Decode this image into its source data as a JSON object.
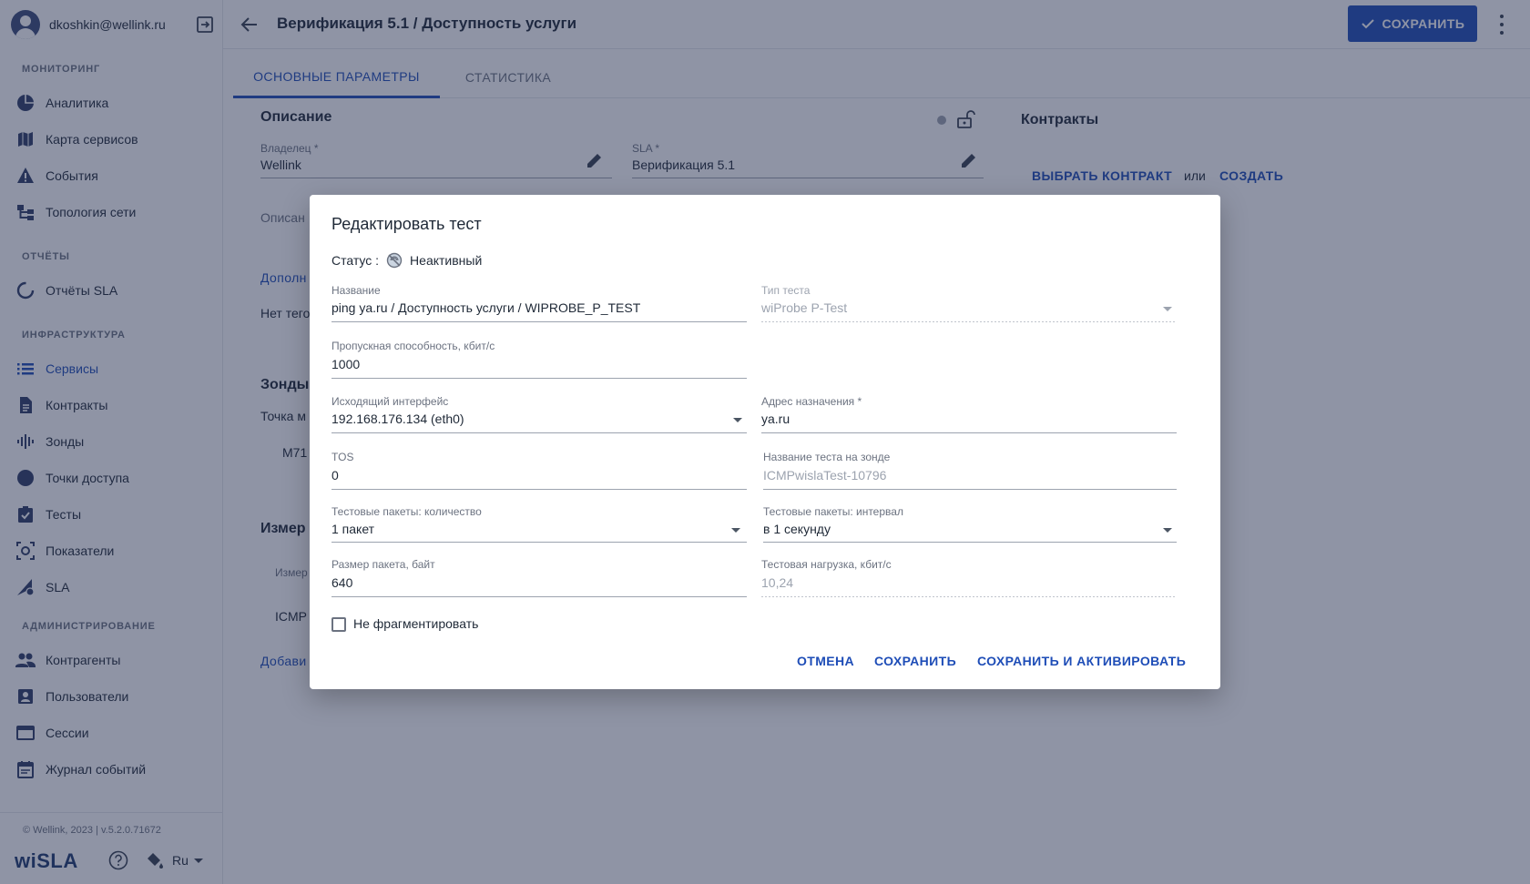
{
  "user": {
    "email": "dkoshkin@wellink.ru"
  },
  "sidebar": {
    "sections": [
      {
        "title": "МОНИТОРИНГ",
        "items": [
          {
            "label": "Аналитика",
            "icon": "pie-chart-icon"
          },
          {
            "label": "Карта сервисов",
            "icon": "map-icon"
          },
          {
            "label": "События",
            "icon": "warning-icon"
          },
          {
            "label": "Топология сети",
            "icon": "topology-icon"
          }
        ]
      },
      {
        "title": "ОТЧЁТЫ",
        "items": [
          {
            "label": "Отчёты SLA",
            "icon": "report-icon"
          }
        ]
      },
      {
        "title": "ИНФРАСТРУКТУРА",
        "items": [
          {
            "label": "Сервисы",
            "icon": "list-icon",
            "active": true
          },
          {
            "label": "Контракты",
            "icon": "document-icon"
          },
          {
            "label": "Зонды",
            "icon": "probe-icon"
          },
          {
            "label": "Точки доступа",
            "icon": "circle-icon"
          },
          {
            "label": "Тесты",
            "icon": "check-box-icon"
          },
          {
            "label": "Показатели",
            "icon": "metrics-icon"
          },
          {
            "label": "SLA",
            "icon": "sla-icon"
          }
        ]
      },
      {
        "title": "АДМИНИСТРИРОВАНИЕ",
        "items": [
          {
            "label": "Контрагенты",
            "icon": "people-icon"
          },
          {
            "label": "Пользователи",
            "icon": "user-card-icon"
          },
          {
            "label": "Сессии",
            "icon": "window-icon"
          },
          {
            "label": "Журнал событий",
            "icon": "calendar-icon"
          }
        ]
      }
    ],
    "footer": {
      "copyright": "© Wellink, 2023 | v.5.2.0.71672",
      "logo": "wiSLA",
      "language": "Ru"
    }
  },
  "header": {
    "title": "Верификация 5.1 / Доступность услуги",
    "save_label": "СОХРАНИТЬ"
  },
  "tabs": [
    {
      "label": "ОСНОВНЫЕ ПАРАМЕТРЫ",
      "active": true
    },
    {
      "label": "СТАТИСТИКА",
      "active": false
    }
  ],
  "main": {
    "description_title": "Описание",
    "owner_label": "Владелец *",
    "owner_value": "Wellink",
    "sla_label": "SLA *",
    "sla_value": "Верификация 5.1",
    "description_partial": "Описан",
    "additional_partial": "Дополн",
    "no_tags_partial": "Нет тего",
    "probes_title_partial": "Зонды",
    "access_point_partial": "Точка м",
    "probe_partial": "M71",
    "measure_title_partial": "Измер",
    "measure_col_partial": "Измер",
    "icmp_partial": "ICMP",
    "add_partial": "Добави",
    "contracts_title": "Контракты",
    "select_contract": "ВЫБРАТЬ КОНТРАКТ",
    "or": "или",
    "create": "СОЗДАТЬ"
  },
  "dialog": {
    "title": "Редактировать тест",
    "status_label": "Статус :",
    "status_value": "Неактивный",
    "fields": {
      "name": {
        "label": "Название",
        "value": "ping ya.ru / Доступность услуги / WIPROBE_P_TEST"
      },
      "test_type": {
        "label": "Тип теста",
        "value": "wiProbe P-Test"
      },
      "bandwidth": {
        "label": "Пропускная способность, кбит/с",
        "value": "1000"
      },
      "out_iface": {
        "label": "Исходящий интерфейс",
        "value": "192.168.176.134 (eth0)"
      },
      "dest_addr": {
        "label": "Адрес назначения *",
        "value": "ya.ru"
      },
      "tos": {
        "label": "TOS",
        "value": "0"
      },
      "probe_test_name": {
        "label": "Название теста на зонде",
        "value": "ICMPwislaTest-10796"
      },
      "pkt_count": {
        "label": "Тестовые пакеты: количество",
        "value": "1 пакет"
      },
      "pkt_interval": {
        "label": "Тестовые пакеты: интервал",
        "value": "в 1 секунду"
      },
      "pkt_size": {
        "label": "Размер пакета, байт",
        "value": "640"
      },
      "load": {
        "label": "Тестовая нагрузка, кбит/с",
        "value": "10,24"
      }
    },
    "no_fragment": "Не фрагментировать",
    "buttons": {
      "cancel": "ОТМЕНА",
      "save": "СОХРАНИТЬ",
      "save_activate": "СОХРАНИТЬ И АКТИВИРОВАТЬ"
    }
  },
  "colors": {
    "accent": "#1e4db7",
    "overlay": "rgba(31,41,75,0.5)"
  }
}
